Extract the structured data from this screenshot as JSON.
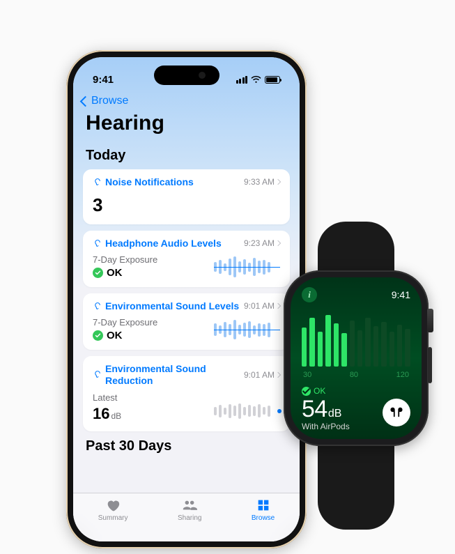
{
  "iphone": {
    "status_time": "9:41",
    "back_label": "Browse",
    "title": "Hearing",
    "section_today": "Today",
    "section_past": "Past 30 Days",
    "cards": {
      "noise": {
        "title": "Noise Notifications",
        "time": "9:33 AM",
        "value": "3"
      },
      "headphone": {
        "title": "Headphone Audio Levels",
        "time": "9:23 AM",
        "sublabel": "7-Day Exposure",
        "status": "OK"
      },
      "env_sound": {
        "title": "Environmental Sound Levels",
        "time": "9:01 AM",
        "sublabel": "7-Day Exposure",
        "status": "OK"
      },
      "env_reduce": {
        "title": "Environmental Sound Reduction",
        "time": "9:01 AM",
        "sublabel": "Latest",
        "value": "16",
        "unit": "dB"
      }
    },
    "tabs": {
      "summary": "Summary",
      "sharing": "Sharing",
      "browse": "Browse"
    }
  },
  "watch": {
    "time": "9:41",
    "scale": {
      "a": "30",
      "b": "80",
      "c": "120"
    },
    "status": "OK",
    "value": "54",
    "unit": "dB",
    "sub": "With AirPods"
  }
}
